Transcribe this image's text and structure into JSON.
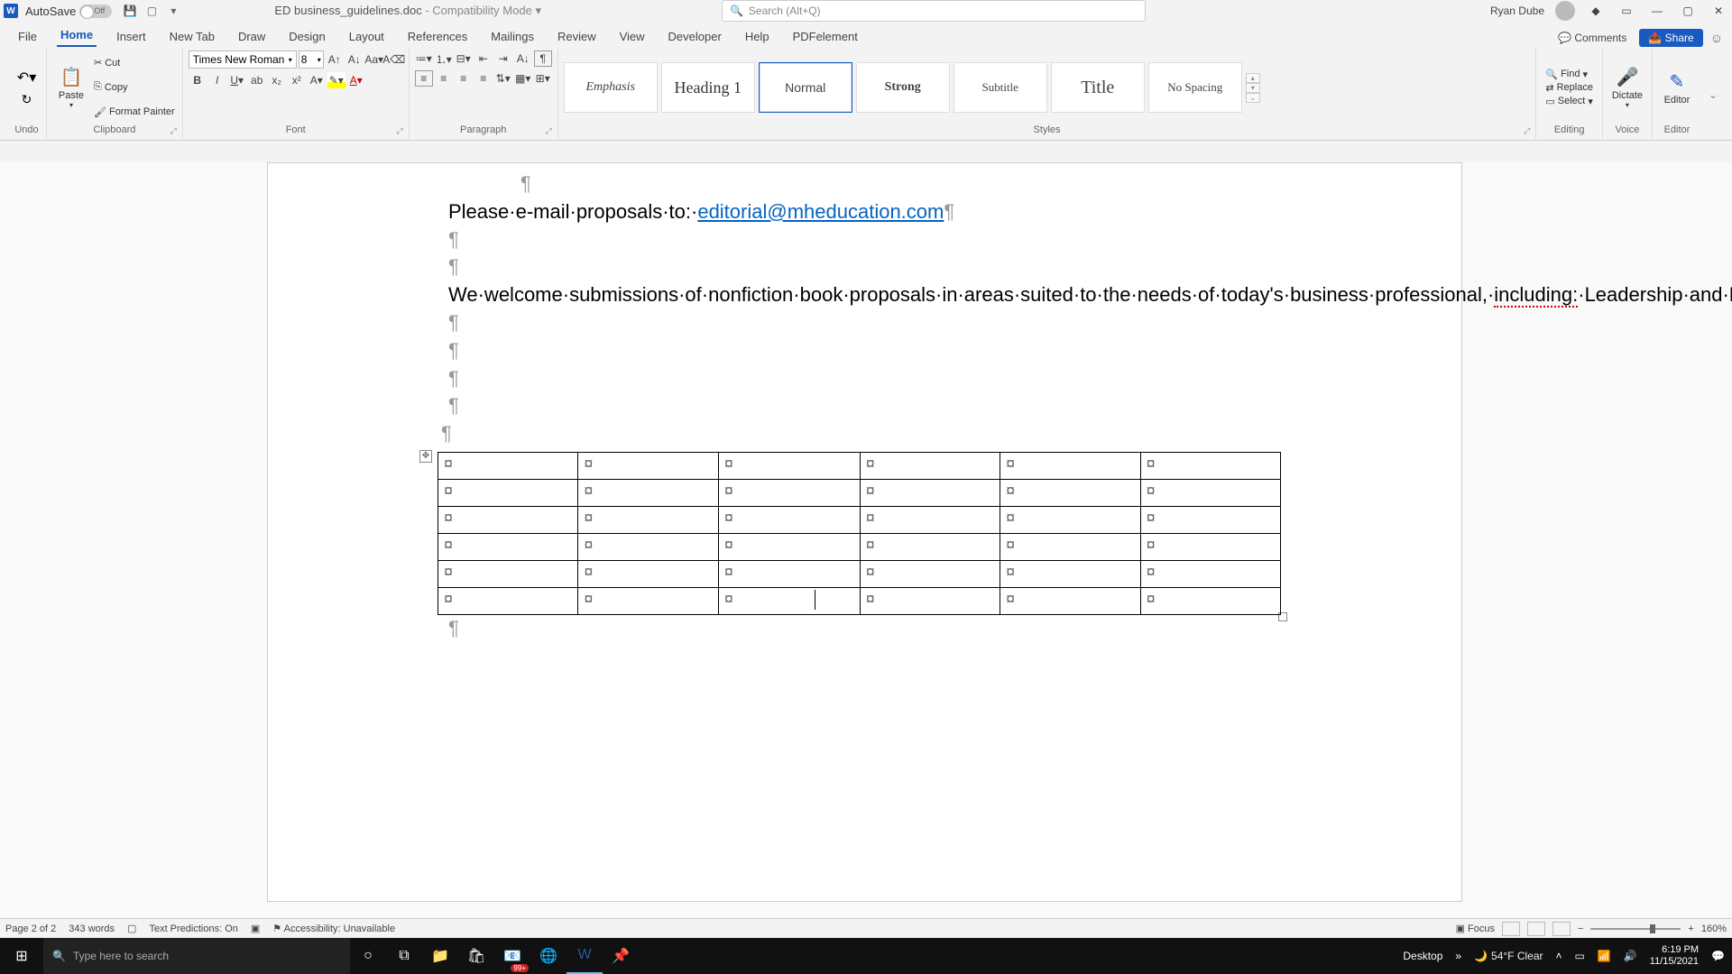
{
  "title_bar": {
    "autosave_label": "AutoSave",
    "autosave_state": "Off",
    "doc_name": "ED business_guidelines.doc",
    "compat": " - Compatibility Mode",
    "search_placeholder": "Search (Alt+Q)",
    "user_name": "Ryan Dube"
  },
  "ribbon_tabs": [
    "File",
    "Home",
    "Insert",
    "New Tab",
    "Draw",
    "Design",
    "Layout",
    "References",
    "Mailings",
    "Review",
    "View",
    "Developer",
    "Help",
    "PDFelement"
  ],
  "ribbon_right": {
    "comments": "Comments",
    "share": "Share"
  },
  "ribbon": {
    "undo_label": "Undo",
    "clipboard": {
      "paste": "Paste",
      "cut": "Cut",
      "copy": "Copy",
      "format_painter": "Format Painter",
      "label": "Clipboard"
    },
    "font": {
      "name": "Times New Roman",
      "size": "8",
      "label": "Font"
    },
    "paragraph_label": "Paragraph",
    "styles": {
      "items": [
        "Emphasis",
        "Heading 1",
        "Normal",
        "Strong",
        "Subtitle",
        "Title",
        "No Spacing"
      ],
      "label": "Styles"
    },
    "editing": {
      "find": "Find",
      "replace": "Replace",
      "select": "Select",
      "label": "Editing"
    },
    "dictate": "Dictate",
    "voice": "Voice",
    "editor": "Editor",
    "editor_label": "Editor"
  },
  "document": {
    "line1_prefix": "Please·e-mail·proposals·to:·",
    "email": "editorial@mheducation.com",
    "body": "We·welcome·submissions·of·nonfiction·book·proposals·in·areas·suited·to·the·needs·of·today's·business·professional,·",
    "including": "including:",
    "body2": "·Leadership·and·Management;·Communication·and·Presentation;·Marketing·and·Sales;·Entrepreneurship·and·Small·Business;·Process·Management,·Operations,·and·Six·Sigma;·Real·Estate;·Coaching·and·Consulting;·Careers;·Economics,·Finance,·and·Investing;·and·the·Business·of·Healthcare/Healthcare·Management.",
    "cell_mark": "¤"
  },
  "status_bar": {
    "page": "Page 2 of 2",
    "words": "343 words",
    "predictions": "Text Predictions: On",
    "accessibility": "Accessibility: Unavailable",
    "focus": "Focus",
    "zoom": "160%"
  },
  "taskbar": {
    "search_placeholder": "Type here to search",
    "desktop": "Desktop",
    "weather": "54°F Clear",
    "time": "6:19 PM",
    "date": "11/15/2021",
    "badge": "99+"
  }
}
